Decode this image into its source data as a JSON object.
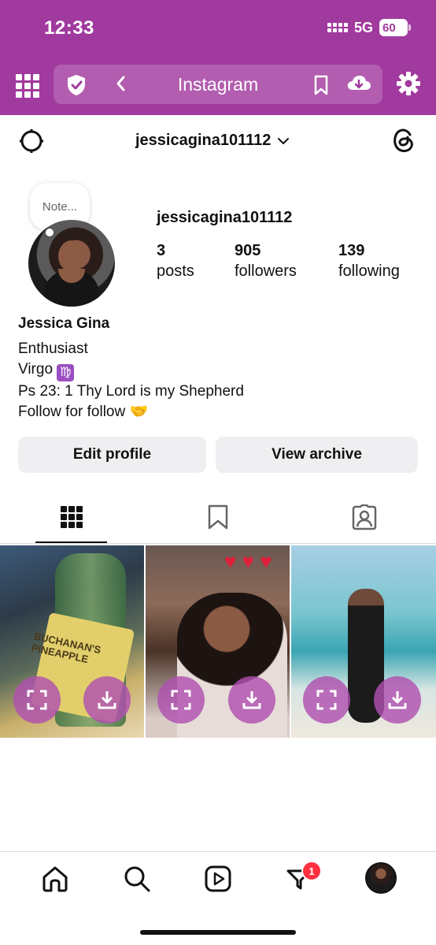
{
  "status_bar": {
    "time": "12:33",
    "network": "5G",
    "battery": "60"
  },
  "browser": {
    "title": "Instagram",
    "icons": [
      "grid-menu-icon",
      "shield-check-icon",
      "back-chevron-icon",
      "bookmark-icon",
      "cloud-download-icon",
      "settings-gear-icon"
    ],
    "accent_color": "#a13a9e"
  },
  "profile": {
    "top_username": "jessicagina101112",
    "note_placeholder": "Note...",
    "username": "jessicagina101112",
    "stats": {
      "posts": {
        "value": "3",
        "label": "posts"
      },
      "followers": {
        "value": "905",
        "label": "followers"
      },
      "following": {
        "value": "139",
        "label": "following"
      }
    },
    "full_name": "Jessica Gina",
    "bio": {
      "line1": "Enthusiast",
      "line2": "Virgo",
      "line2_emoji": "♍",
      "line3": "Ps 23: 1 Thy Lord is my Shepherd",
      "line4": "Follow for follow",
      "line4_emoji": "🤝"
    }
  },
  "actions": {
    "edit_profile": "Edit profile",
    "view_archive": "View archive"
  },
  "tabs": [
    "posts-grid-icon",
    "saved-icon",
    "tagged-icon"
  ],
  "posts": [
    {
      "label_text": "BUCHANAN'S PINEAPPLE"
    },
    {
      "hearts": "♥ ♥ ♥"
    },
    {}
  ],
  "bottom_nav": {
    "notification_count": "1"
  }
}
